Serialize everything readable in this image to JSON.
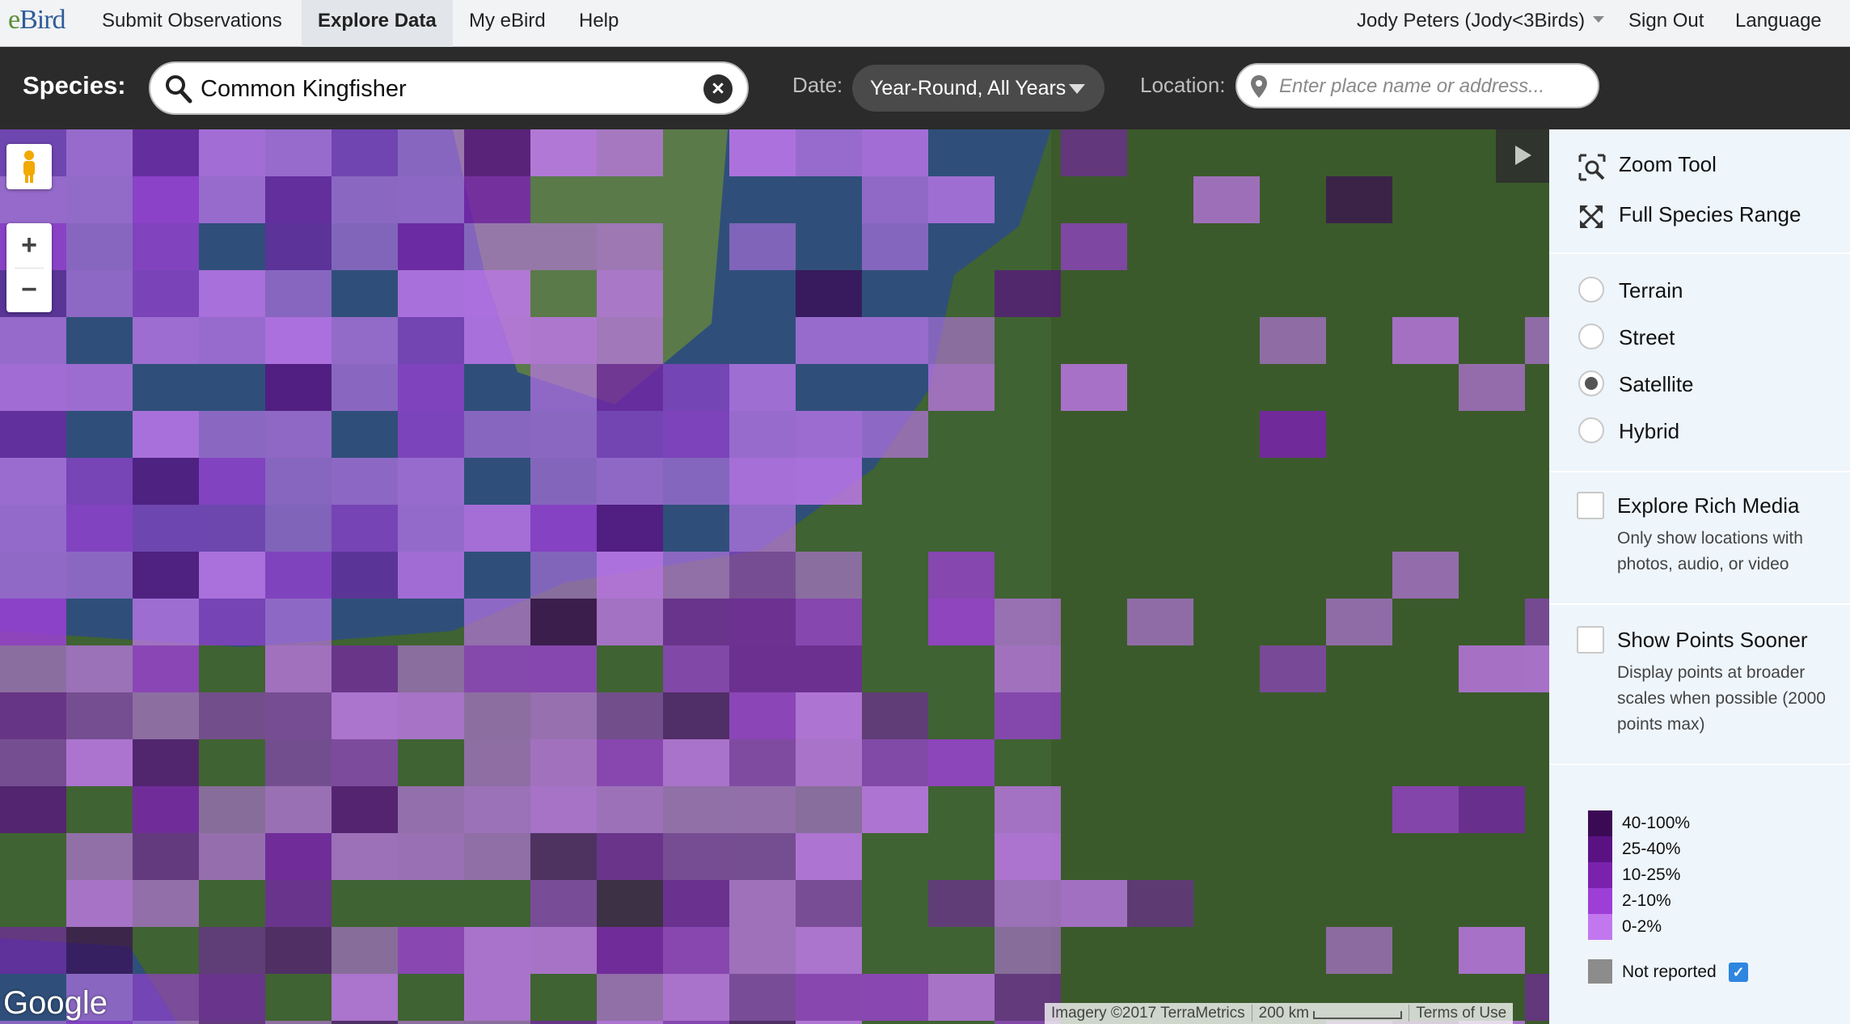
{
  "nav": {
    "logo_e": "e",
    "logo_bird": "Bird",
    "items": [
      "Submit Observations",
      "Explore Data",
      "My eBird",
      "Help"
    ],
    "active": "Explore Data",
    "user": "Jody Peters (Jody<3Birds)",
    "sign_out": "Sign Out",
    "language": "Language"
  },
  "search": {
    "species_label": "Species:",
    "species_value": "Common Kingfisher",
    "date_label": "Date:",
    "date_value": "Year-Round, All Years",
    "location_label": "Location:",
    "location_placeholder": "Enter place name or address..."
  },
  "map": {
    "google_label": "Google",
    "imagery": "Imagery ©2017 TerraMetrics",
    "scale": "200 km",
    "terms": "Terms of Use",
    "zoom_in": "+",
    "zoom_out": "−"
  },
  "panel": {
    "zoom_tool": "Zoom Tool",
    "full_range": "Full Species Range",
    "map_types": [
      "Terrain",
      "Street",
      "Satellite",
      "Hybrid"
    ],
    "selected_map_type": "Satellite",
    "rich_media_title": "Explore Rich Media",
    "rich_media_desc": "Only show locations with photos, audio, or video",
    "points_sooner_title": "Show Points Sooner",
    "points_sooner_desc": "Display points at broader scales when possible (2000 points max)",
    "legend": [
      {
        "label": "40-100%",
        "color": "#3b0a55"
      },
      {
        "label": "25-40%",
        "color": "#5a1283"
      },
      {
        "label": "10-25%",
        "color": "#7a22ad"
      },
      {
        "label": "2-10%",
        "color": "#9d3fd6"
      },
      {
        "label": "0-2%",
        "color": "#c377ef"
      }
    ],
    "not_reported": "Not reported",
    "not_reported_checked": true
  }
}
